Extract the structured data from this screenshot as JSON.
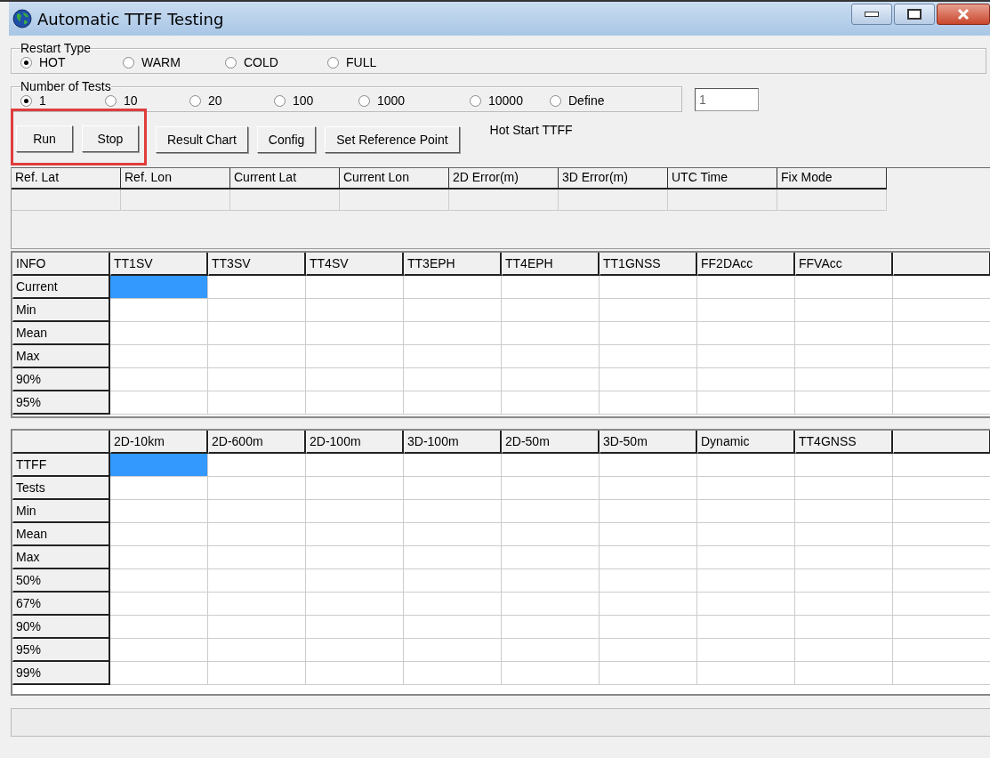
{
  "window": {
    "title": "Automatic TTFF Testing"
  },
  "restart_type": {
    "label": "Restart Type",
    "options": [
      {
        "label": "HOT",
        "selected": true
      },
      {
        "label": "WARM",
        "selected": false
      },
      {
        "label": "COLD",
        "selected": false
      },
      {
        "label": "FULL",
        "selected": false
      }
    ]
  },
  "number_of_tests": {
    "label": "Number of Tests",
    "options": [
      {
        "label": "1",
        "selected": true
      },
      {
        "label": "10",
        "selected": false
      },
      {
        "label": "20",
        "selected": false
      },
      {
        "label": "100",
        "selected": false
      },
      {
        "label": "1000",
        "selected": false
      },
      {
        "label": "10000",
        "selected": false
      },
      {
        "label": "Define",
        "selected": false
      }
    ],
    "define_value": "1"
  },
  "buttons": [
    {
      "label": "Run",
      "highlighted": true
    },
    {
      "label": "Stop",
      "highlighted": true
    },
    {
      "label": "Result Chart",
      "highlighted": false
    },
    {
      "label": "Config",
      "highlighted": false
    },
    {
      "label": "Set Reference Point",
      "highlighted": false
    }
  ],
  "status_text": "Hot Start TTFF",
  "position_table": {
    "columns": [
      "Ref. Lat",
      "Ref. Lon",
      "Current Lat",
      "Current Lon",
      "2D Error(m)",
      "3D Error(m)",
      "UTC Time",
      "Fix Mode"
    ]
  },
  "info_table": {
    "corner": "INFO",
    "columns": [
      "TT1SV",
      "TT3SV",
      "TT4SV",
      "TT3EPH",
      "TT4EPH",
      "TT1GNSS",
      "FF2DAcc",
      "FFVAcc"
    ],
    "rows": [
      {
        "label": "Current",
        "selected": true
      },
      {
        "label": "Min",
        "selected": false
      },
      {
        "label": "Mean",
        "selected": false
      },
      {
        "label": "Max",
        "selected": false
      },
      {
        "label": "90%",
        "selected": false
      },
      {
        "label": "95%",
        "selected": false
      }
    ]
  },
  "ttff_table": {
    "columns": [
      "2D-10km",
      "2D-600m",
      "2D-100m",
      "3D-100m",
      "2D-50m",
      "3D-50m",
      "Dynamic",
      "TT4GNSS"
    ],
    "rows": [
      {
        "label": "TTFF",
        "selected": true
      },
      {
        "label": "Tests",
        "selected": false
      },
      {
        "label": "Min",
        "selected": false
      },
      {
        "label": "Mean",
        "selected": false
      },
      {
        "label": "Max",
        "selected": false
      },
      {
        "label": "50%",
        "selected": false
      },
      {
        "label": "67%",
        "selected": false
      },
      {
        "label": "90%",
        "selected": false
      },
      {
        "label": "95%",
        "selected": false
      },
      {
        "label": "99%",
        "selected": false
      }
    ]
  }
}
